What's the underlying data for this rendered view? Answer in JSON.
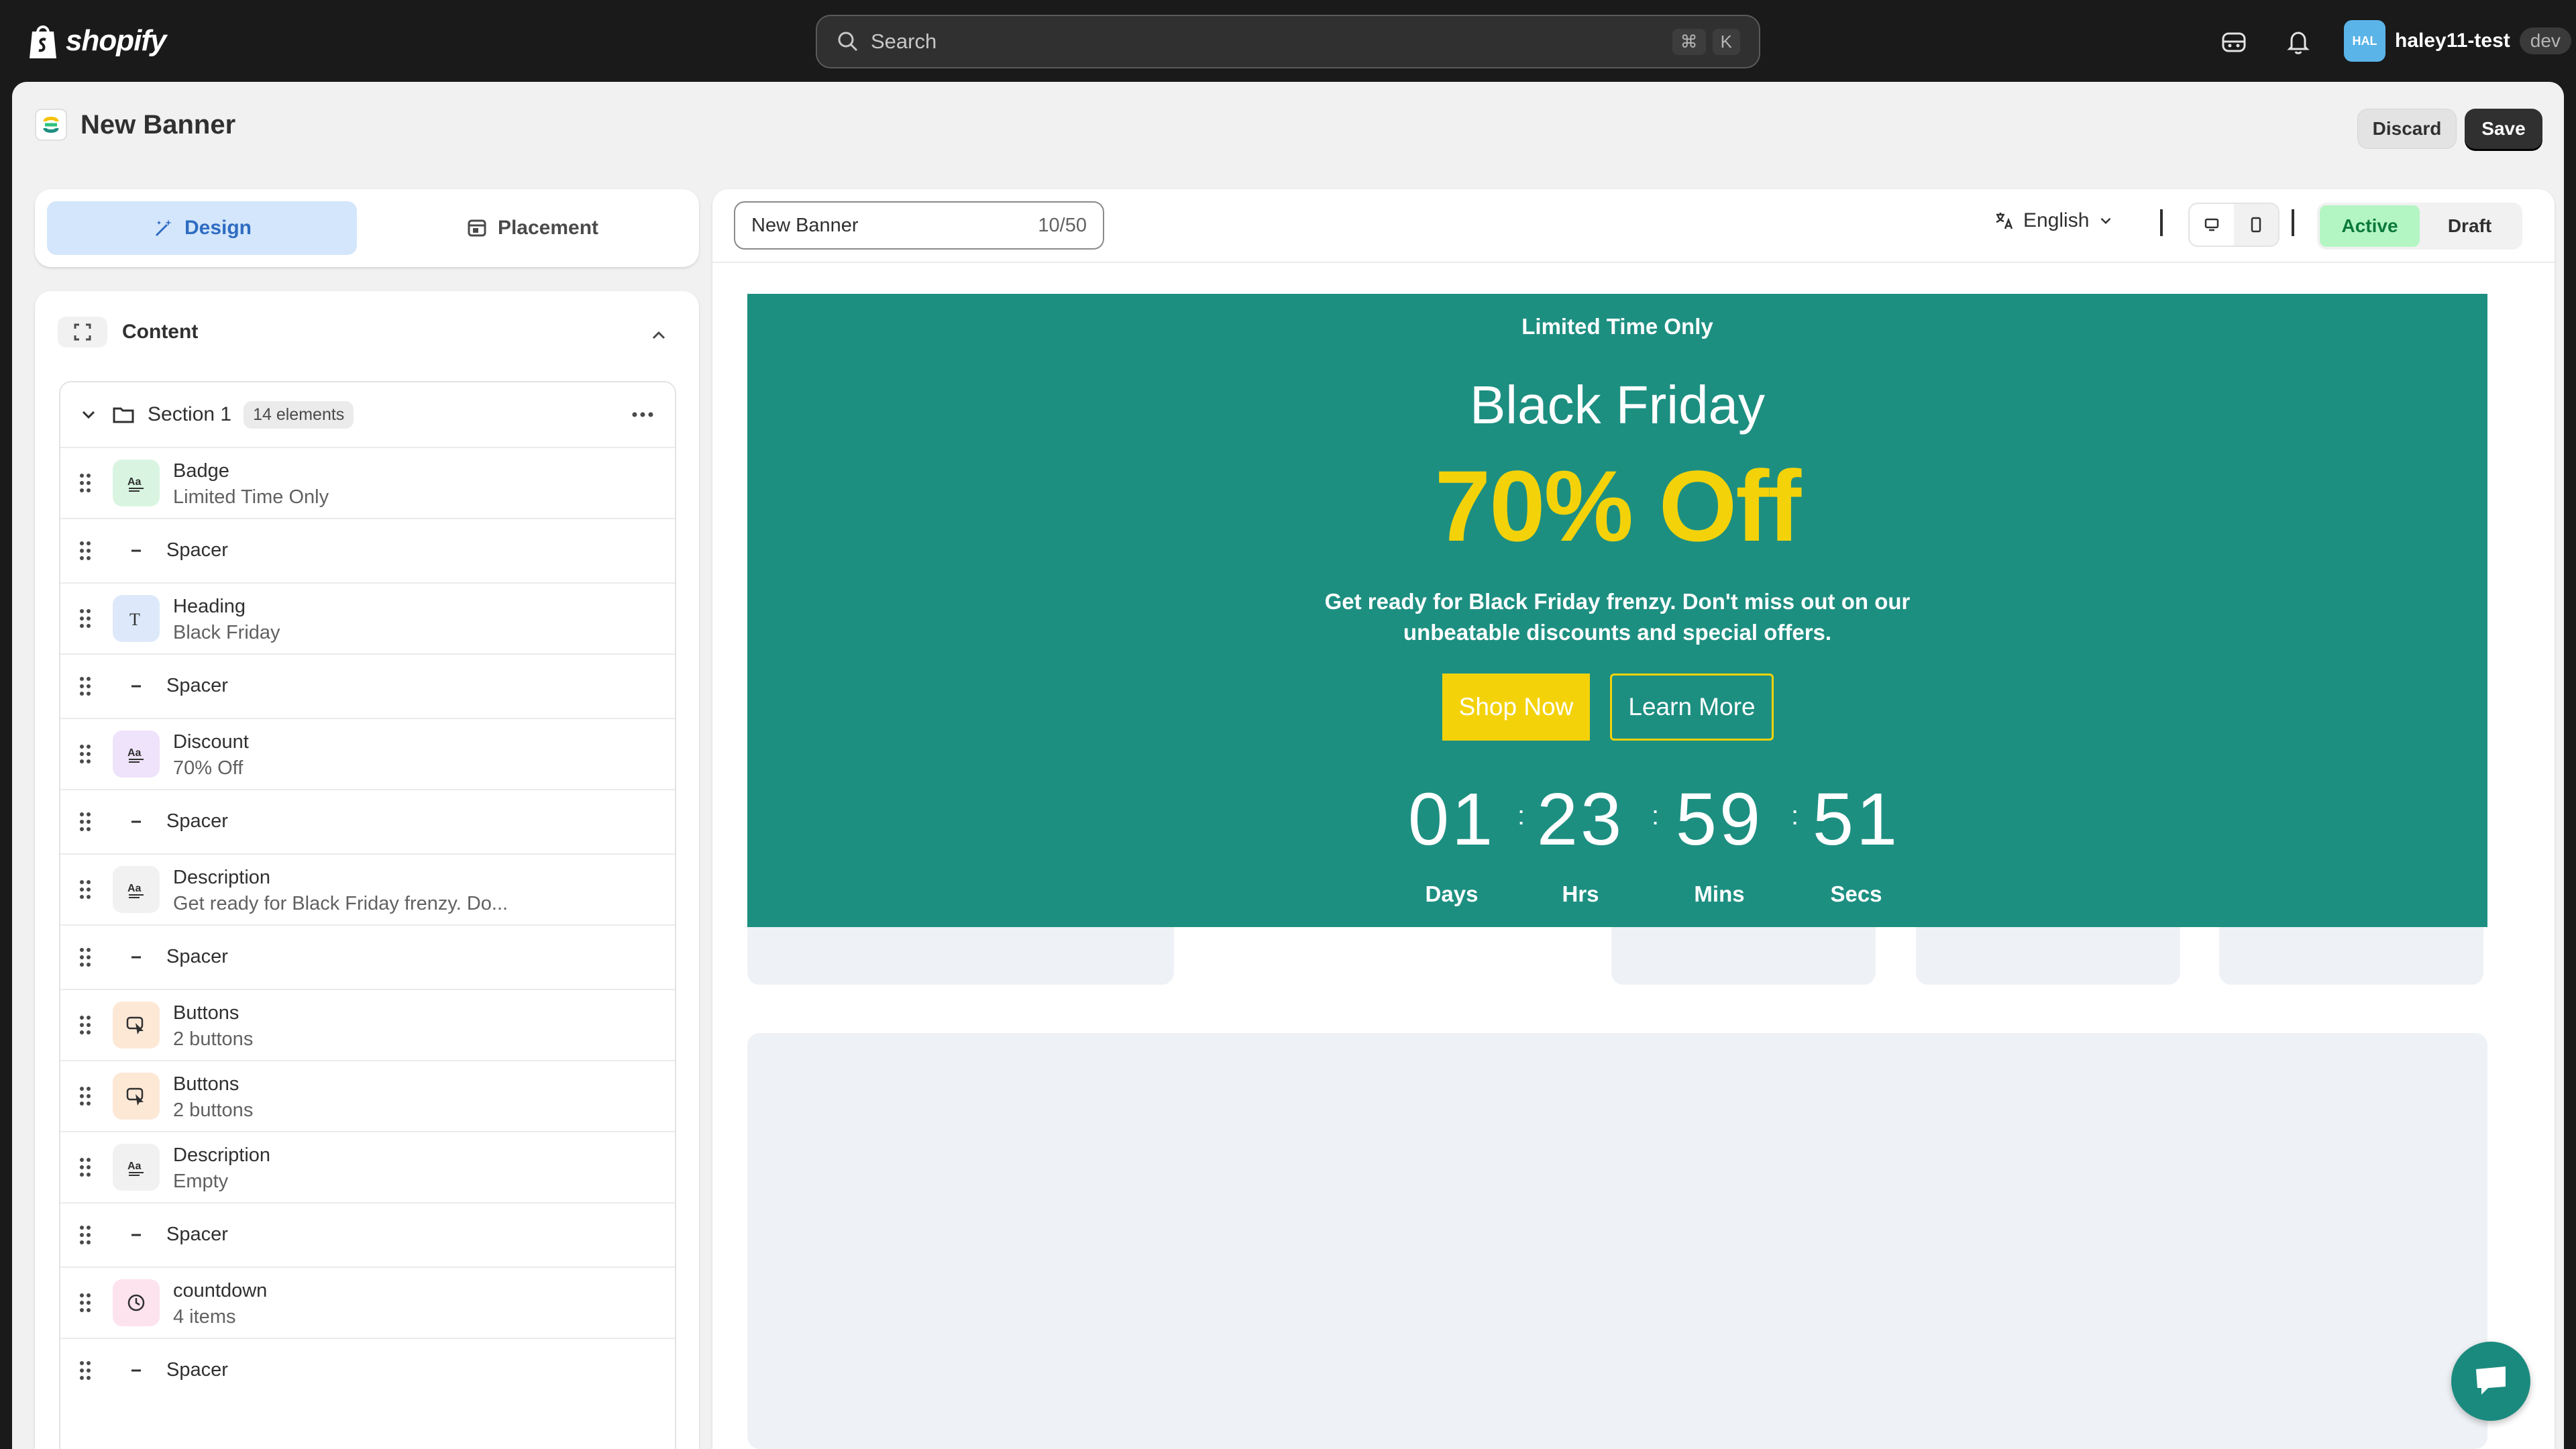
{
  "topbar": {
    "logo_text": "shopify",
    "search_placeholder": "Search",
    "shortcut_cmd": "⌘",
    "shortcut_key": "K",
    "avatar_initials": "HAL",
    "account_name": "haley11-test",
    "env_tag": "dev"
  },
  "header": {
    "title": "New Banner",
    "discard_label": "Discard",
    "save_label": "Save"
  },
  "left": {
    "tabs": [
      {
        "label": "Design",
        "icon": "magic-wand-icon",
        "active": true
      },
      {
        "label": "Placement",
        "icon": "layout-icon",
        "active": false
      }
    ],
    "content_label": "Content",
    "section": {
      "title": "Section 1",
      "count": "14 elements"
    },
    "elements": [
      {
        "name": "Badge",
        "sub": "Limited Time Only",
        "icon": "text-icon",
        "bg": "#d9f5e2"
      },
      {
        "name": "Spacer",
        "sub": "",
        "icon": "minus-icon",
        "bg": ""
      },
      {
        "name": "Heading",
        "sub": "Black Friday",
        "icon": "heading-icon",
        "bg": "#dde9fb"
      },
      {
        "name": "Spacer",
        "sub": "",
        "icon": "minus-icon",
        "bg": ""
      },
      {
        "name": "Discount",
        "sub": "70% Off",
        "icon": "text-icon",
        "bg": "#efe3fb"
      },
      {
        "name": "Spacer",
        "sub": "",
        "icon": "minus-icon",
        "bg": ""
      },
      {
        "name": "Description",
        "sub": "Get ready for Black Friday frenzy. Do...",
        "icon": "text-icon",
        "bg": "#f1f1f1"
      },
      {
        "name": "Spacer",
        "sub": "",
        "icon": "minus-icon",
        "bg": ""
      },
      {
        "name": "Buttons",
        "sub": "2 buttons",
        "icon": "cursor-icon",
        "bg": "#fde8d6"
      },
      {
        "name": "Buttons",
        "sub": "2 buttons",
        "icon": "cursor-icon",
        "bg": "#fde8d6"
      },
      {
        "name": "Description",
        "sub": "Empty",
        "icon": "text-icon",
        "bg": "#f1f1f1"
      },
      {
        "name": "Spacer",
        "sub": "",
        "icon": "minus-icon",
        "bg": ""
      },
      {
        "name": "countdown",
        "sub": "4 items",
        "icon": "clock-icon",
        "bg": "#fde3ee"
      },
      {
        "name": "Spacer",
        "sub": "",
        "icon": "minus-icon",
        "bg": ""
      }
    ]
  },
  "editor": {
    "name_value": "New Banner",
    "name_counter": "10/50",
    "language": "English",
    "status_active": "Active",
    "status_draft": "Draft"
  },
  "banner": {
    "badge": "Limited Time Only",
    "heading": "Black Friday",
    "discount": "70% Off",
    "description": "Get ready for Black Friday frenzy. Don't miss out on our unbeatable discounts and special offers.",
    "primary_button": "Shop Now",
    "secondary_button": "Learn More",
    "countdown": [
      {
        "value": "01",
        "label": "Days"
      },
      {
        "value": "23",
        "label": "Hrs"
      },
      {
        "value": "59",
        "label": "Mins"
      },
      {
        "value": "51",
        "label": "Secs"
      }
    ],
    "colors": {
      "background": "#1d8f81",
      "accent": "#f4d20a",
      "text": "#ffffff"
    }
  }
}
